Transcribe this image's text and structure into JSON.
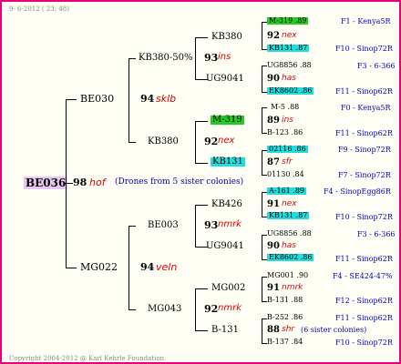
{
  "header": {
    "date": "9-  6-2012 ( 23: 48)"
  },
  "footer": {
    "copyright": "Copyright 2004-2012 @ Karl Kehrle Foundation."
  },
  "root": {
    "id": "BE036",
    "score": "98",
    "code": "hof",
    "note": "(Drones from 5 sister colonies)"
  },
  "gen1": [
    {
      "id": "BE030",
      "score": "94",
      "code": "sklb"
    },
    {
      "id": "MG022",
      "score": "94",
      "code": "veln"
    }
  ],
  "gen2": [
    {
      "id": "KB380-50%",
      "score": "93",
      "code": "ins"
    },
    {
      "id": "KB380",
      "score": "92",
      "code": "nex"
    },
    {
      "id": "BE003",
      "score": "93",
      "code": "nmrk"
    },
    {
      "id": "MG043",
      "score": "92",
      "code": "nmrk"
    }
  ],
  "gen3": [
    {
      "id": "KB380",
      "highlight": ""
    },
    {
      "id": "UG9041",
      "highlight": ""
    },
    {
      "id": "M-319",
      "highlight": "green"
    },
    {
      "id": "KB131",
      "highlight": "cyan"
    },
    {
      "id": "KB426",
      "highlight": ""
    },
    {
      "id": "UG9041",
      "highlight": ""
    },
    {
      "id": "MG002",
      "highlight": ""
    },
    {
      "id": "B-131",
      "highlight": ""
    }
  ],
  "gen4": [
    {
      "top": "M-319 .89",
      "top_hl": "green",
      "mid_score": "92",
      "mid_code": "nex",
      "bot": "KB131 .87",
      "bot_hl": "cyan",
      "src_top": "F1 - Kenya5R",
      "src_bot": "F10 - Sinop72R"
    },
    {
      "top": "UG8856 .88",
      "top_hl": "",
      "mid_score": "90",
      "mid_code": "has",
      "bot": "EK8602 .86",
      "bot_hl": "cyan",
      "src_top": "F3 - 6-366",
      "src_bot": "F11 - Sinop62R"
    },
    {
      "top": "M-5 .88",
      "top_hl": "",
      "mid_score": "89",
      "mid_code": "ins",
      "bot": "B-123 .86",
      "bot_hl": "",
      "src_top": "F0 - Kenya5R",
      "src_bot": "F11 - Sinop62R"
    },
    {
      "top": "02116 .86",
      "top_hl": "cyan",
      "mid_score": "87",
      "mid_code": "sfr",
      "bot": "01130 .84",
      "bot_hl": "",
      "src_top": "F9 - Sinop72R",
      "src_bot": "F7 - Sinop72R"
    },
    {
      "top": "A-161 .89",
      "top_hl": "cyan",
      "mid_score": "91",
      "mid_code": "nex",
      "bot": "KB131 .87",
      "bot_hl": "cyan",
      "src_top": "F4 - SinopEgg86R",
      "src_bot": "F10 - Sinop72R"
    },
    {
      "top": "UG8856 .88",
      "top_hl": "",
      "mid_score": "90",
      "mid_code": "has",
      "bot": "EK8602 .86",
      "bot_hl": "cyan",
      "src_top": "F3 - 6-366",
      "src_bot": "F11 - Sinop62R"
    },
    {
      "top": "MG001 .90",
      "top_hl": "",
      "mid_score": "91",
      "mid_code": "nmrk",
      "bot": "B-131 .88",
      "bot_hl": "",
      "src_top": "F4 - SE424-47%",
      "src_bot": "F12 - Sinop62R"
    },
    {
      "top": "B-252 .86",
      "top_hl": "",
      "mid_score": "88",
      "mid_code": "shr",
      "mid_note": "(6 sister colonies)",
      "bot": "B-137 .84",
      "bot_hl": "",
      "src_top": "F11 - Sinop62R",
      "src_bot": "F10 - Sinop72R"
    }
  ]
}
